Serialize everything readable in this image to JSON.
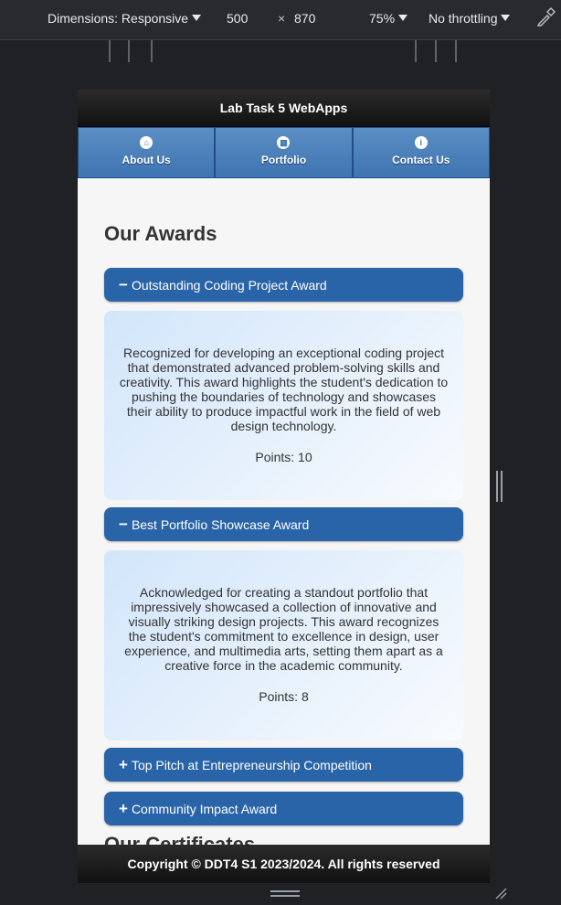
{
  "devtools": {
    "dimensions_label": "Dimensions: Responsive",
    "width_value": "500",
    "times": "×",
    "height_value": "870",
    "zoom": "75%",
    "throttling": "No throttling"
  },
  "app": {
    "title": "Lab Task 5 WebApps",
    "nav": [
      {
        "label": "About Us",
        "icon": "home-icon",
        "glyph": "⌂"
      },
      {
        "label": "Portfolio",
        "icon": "grid-icon",
        "glyph": "▦"
      },
      {
        "label": "Contact Us",
        "icon": "info-icon",
        "glyph": "i"
      }
    ],
    "heading": "Our Awards",
    "awards": [
      {
        "title": "Outstanding Coding Project Award",
        "expanded": true,
        "symbol": "−",
        "description": "Recognized for developing an exceptional coding project that demonstrated advanced problem-solving skills and creativity. This award highlights the student's dedication to pushing the boundaries of technology and showcases their ability to produce impactful work in the field of web design technology.",
        "points": "Points: 10"
      },
      {
        "title": "Best Portfolio Showcase Award",
        "expanded": true,
        "symbol": "−",
        "description": "Acknowledged for creating a standout portfolio that impressively showcased a collection of innovative and visually striking design projects. This award recognizes the student's commitment to excellence in design, user experience, and multimedia arts, setting them apart as a creative force in the academic community.",
        "points": "Points: 8"
      },
      {
        "title": "Top Pitch at Entrepreneurship Competition",
        "expanded": false,
        "symbol": "+"
      },
      {
        "title": "Community Impact Award",
        "expanded": false,
        "symbol": "+"
      }
    ],
    "next_heading": "Our Certificates",
    "footer": "Copyright © DDT4 S1 2023/2024. All rights reserved"
  },
  "colors": {
    "accordion_header": "#2a64a8",
    "nav_button": "#3e74b1",
    "devtools_bg": "#292a2d"
  }
}
